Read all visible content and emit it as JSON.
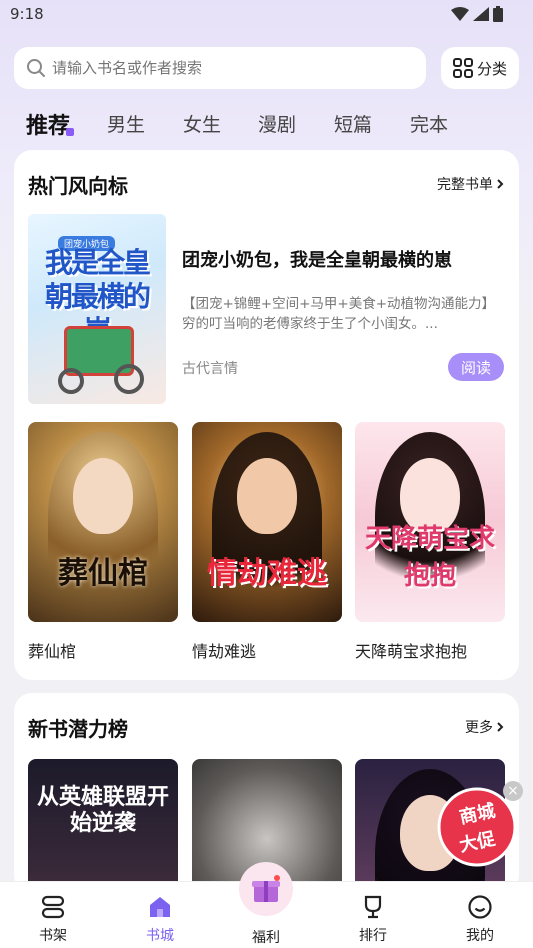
{
  "status_bar": {
    "time": "9:18"
  },
  "search": {
    "placeholder": "请输入书名或作者搜索",
    "category_label": "分类"
  },
  "tabs": [
    {
      "label": "推荐",
      "active": true
    },
    {
      "label": "男生"
    },
    {
      "label": "女生"
    },
    {
      "label": "漫剧"
    },
    {
      "label": "短篇"
    },
    {
      "label": "完本"
    }
  ],
  "hot_section": {
    "title": "热门风向标",
    "more_label": "完整书单",
    "featured": {
      "cover_title": "我是全皇朝最横的崽",
      "cover_tag": "团宠小奶包",
      "title": "团宠小奶包，我是全皇朝最横的崽",
      "description": "【团宠+锦鲤+空间+马甲+美食+动植物沟通能力】穷的叮当响的老傅家终于生了个小闺女。...",
      "genre": "古代言情",
      "read_label": "阅读"
    },
    "books": [
      {
        "title": "葬仙棺",
        "cover_text": "葬仙棺"
      },
      {
        "title": "情劫难逃",
        "cover_text": "情劫难逃"
      },
      {
        "title": "天降萌宝求抱抱",
        "cover_text": "天降萌宝求抱抱"
      }
    ]
  },
  "new_section": {
    "title": "新书潜力榜",
    "more_label": "更多",
    "books": [
      {
        "cover_text": "从英雄联盟开始逆袭"
      },
      {
        "cover_text": ""
      },
      {
        "cover_text": ""
      }
    ]
  },
  "promo": {
    "text_line1": "商城",
    "text_line2": "大促"
  },
  "bottom_nav": [
    {
      "label": "书架",
      "icon": "bookshelf-icon"
    },
    {
      "label": "书城",
      "icon": "home-icon",
      "active": true
    },
    {
      "label": "福利",
      "icon": "gift-icon"
    },
    {
      "label": "排行",
      "icon": "trophy-icon"
    },
    {
      "label": "我的",
      "icon": "smile-icon"
    }
  ],
  "colors": {
    "accent": "#7b62f0",
    "read_button": "#a78ef8"
  }
}
